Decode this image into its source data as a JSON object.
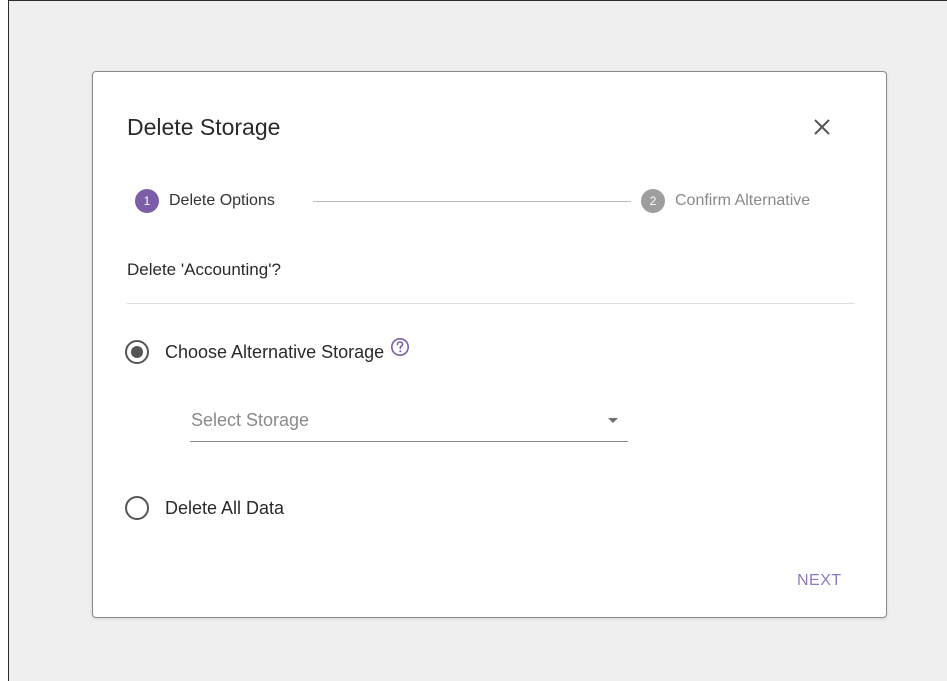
{
  "dialog": {
    "title": "Delete Storage",
    "close_icon": "close-icon",
    "accent_color": "#7b5ea7",
    "stepper": {
      "steps": [
        {
          "number": "1",
          "label": "Delete Options",
          "state": "active",
          "color": "#7b5ea7"
        },
        {
          "number": "2",
          "label": "Confirm Alternative",
          "state": "inactive",
          "color": "#9e9e9e"
        }
      ]
    },
    "question": "Delete 'Accounting'?",
    "options": {
      "alternative": {
        "label": "Choose Alternative Storage",
        "checked": true,
        "help_icon": "help-circle-icon"
      },
      "select": {
        "placeholder": "Select Storage",
        "value": ""
      },
      "delete_all": {
        "label": "Delete All Data",
        "checked": false
      }
    },
    "next_label": "NEXT"
  }
}
